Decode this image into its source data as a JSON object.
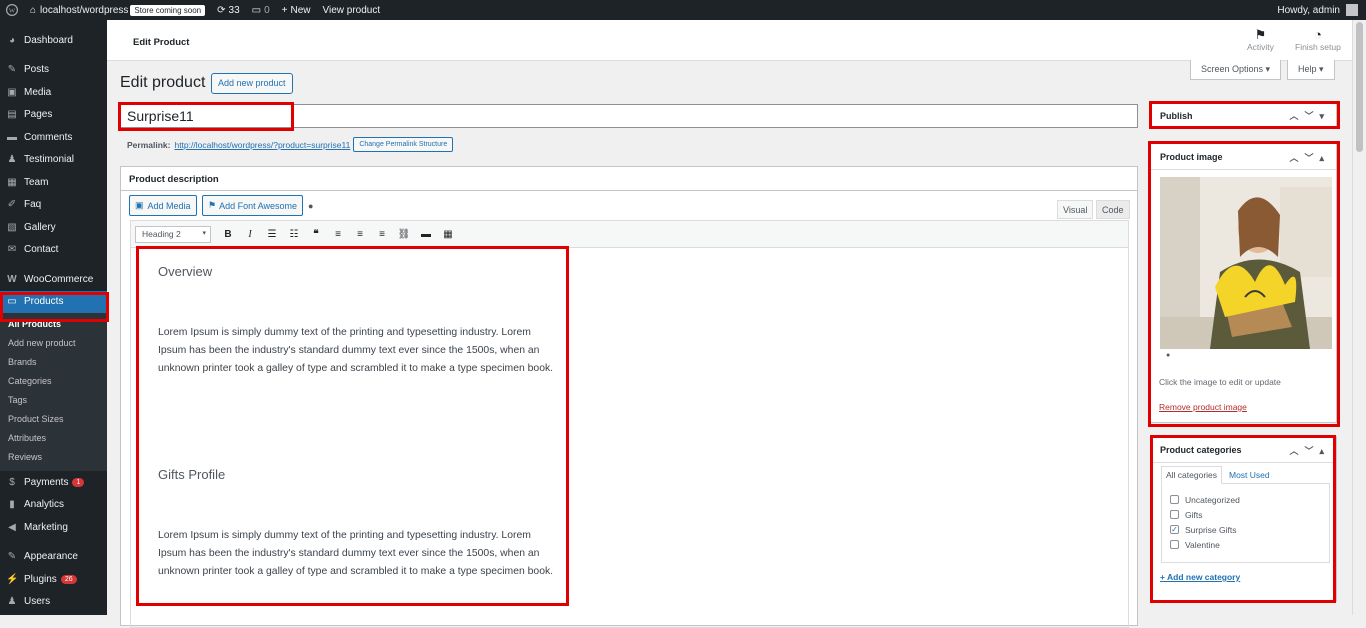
{
  "adminbar": {
    "wp_logo": "wordpress-icon",
    "site": "localhost/wordpress",
    "store_badge": "Store coming soon",
    "updates": "33",
    "comments": "0",
    "new": "New",
    "view": "View product",
    "howdy": "Howdy, admin"
  },
  "sidebar": {
    "items": [
      {
        "label": "Dashboard",
        "icon": "dashboard-icon"
      },
      {
        "label": "Posts",
        "icon": "pin-icon"
      },
      {
        "label": "Media",
        "icon": "media-icon"
      },
      {
        "label": "Pages",
        "icon": "pages-icon"
      },
      {
        "label": "Comments",
        "icon": "comments-icon"
      },
      {
        "label": "Testimonial",
        "icon": "person-icon"
      },
      {
        "label": "Team",
        "icon": "team-icon"
      },
      {
        "label": "Faq",
        "icon": "faq-icon"
      },
      {
        "label": "Gallery",
        "icon": "gallery-icon"
      },
      {
        "label": "Contact",
        "icon": "mail-icon"
      },
      {
        "label": "WooCommerce",
        "icon": "woo-icon"
      },
      {
        "label": "Products",
        "icon": "products-icon"
      },
      {
        "label": "Payments",
        "icon": "payments-icon",
        "badge": "1"
      },
      {
        "label": "Analytics",
        "icon": "analytics-icon"
      },
      {
        "label": "Marketing",
        "icon": "marketing-icon"
      },
      {
        "label": "Appearance",
        "icon": "appearance-icon"
      },
      {
        "label": "Plugins",
        "icon": "plugins-icon",
        "badge": "26"
      },
      {
        "label": "Users",
        "icon": "users-icon"
      }
    ],
    "submenu": [
      "All Products",
      "Add new product",
      "Brands",
      "Categories",
      "Tags",
      "Product Sizes",
      "Attributes",
      "Reviews"
    ]
  },
  "topbar": {
    "title": "Edit Product",
    "activity": "Activity",
    "finish": "Finish setup",
    "screen_options": "Screen Options ▾",
    "help": "Help ▾"
  },
  "page": {
    "heading": "Edit product",
    "add_new": "Add new product",
    "title_value": "Surprise11",
    "permalink_label": "Permalink:",
    "permalink_url": "http://localhost/wordpress/?product=surprise11",
    "change_permalink": "Change Permalink Structure"
  },
  "description": {
    "header": "Product description",
    "add_media": "Add Media",
    "add_font": "Add Font Awesome",
    "tab_visual": "Visual",
    "tab_code": "Code",
    "format": "Heading 2",
    "h1": "Overview",
    "p1": "Lorem Ipsum is simply dummy text of the printing and typesetting industry. Lorem Ipsum has been the industry's standard dummy text ever since the 1500s, when an unknown printer took a galley of type and scrambled it to make a type specimen book.",
    "h2": "Gifts Profile",
    "p2": "Lorem Ipsum is simply dummy text of the printing and typesetting industry. Lorem Ipsum has been the industry's standard dummy text ever since the 1500s, when an unknown printer took a galley of type and scrambled it to make a type specimen book."
  },
  "publish": {
    "header": "Publish"
  },
  "product_image": {
    "header": "Product image",
    "hint": "Click the image to edit or update",
    "remove": "Remove product image"
  },
  "categories": {
    "header": "Product categories",
    "tab_all": "All categories",
    "tab_used": "Most Used",
    "items": [
      {
        "label": "Uncategorized",
        "checked": false
      },
      {
        "label": "Gifts",
        "checked": false
      },
      {
        "label": "Surprise Gifts",
        "checked": true
      },
      {
        "label": "Valentine",
        "checked": false
      }
    ],
    "add_new": "+ Add new category"
  },
  "colors": {
    "accent": "#2271b1",
    "sidebar": "#1d2327",
    "highlight": "#e00000"
  }
}
